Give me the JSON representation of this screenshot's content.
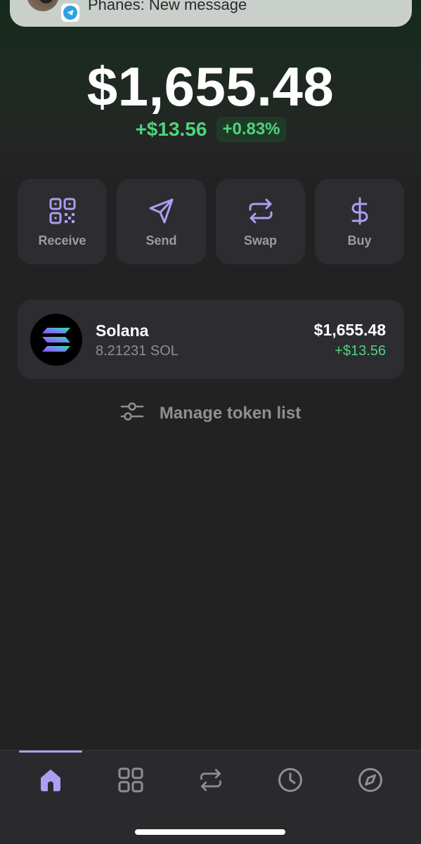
{
  "notification": {
    "text": "Phanes: New message",
    "app_icon": "telegram-icon"
  },
  "portfolio": {
    "balance": "$1,655.48",
    "change_amount": "+$13.56",
    "change_percent": "+0.83%"
  },
  "actions": [
    {
      "label": "Receive",
      "icon": "qr-code-icon"
    },
    {
      "label": "Send",
      "icon": "send-icon"
    },
    {
      "label": "Swap",
      "icon": "swap-icon"
    },
    {
      "label": "Buy",
      "icon": "dollar-icon"
    }
  ],
  "tokens": [
    {
      "name": "Solana",
      "amount": "8.21231 SOL",
      "value": "$1,655.48",
      "change": "+$13.56",
      "icon": "solana-logo-icon"
    }
  ],
  "manage_tokens": {
    "label": "Manage token list",
    "icon": "sliders-icon"
  },
  "bottom_nav": {
    "items": [
      {
        "icon": "home-icon",
        "active": true
      },
      {
        "icon": "grid-icon",
        "active": false
      },
      {
        "icon": "swap-icon",
        "active": false
      },
      {
        "icon": "clock-icon",
        "active": false
      },
      {
        "icon": "compass-icon",
        "active": false
      }
    ]
  },
  "colors": {
    "accent": "#ab9ff2",
    "positive": "#4fd37b",
    "background": "#222222",
    "card": "#2c2c31"
  }
}
